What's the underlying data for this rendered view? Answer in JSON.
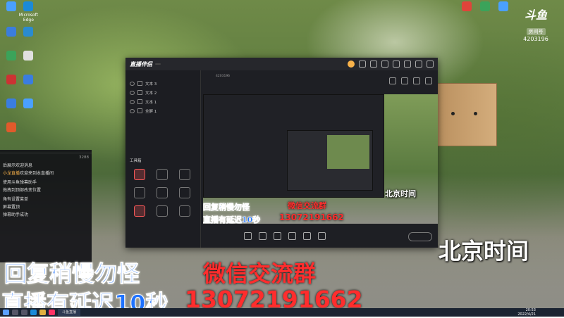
{
  "desktop": {
    "icons": [
      {
        "label": "",
        "color": "#4aa0ff"
      },
      {
        "label": "Microsoft Edge",
        "color": "#1b8ad8"
      },
      {
        "label": "",
        "color": "#3b7ddd"
      },
      {
        "label": "",
        "color": "#2a8bd0"
      },
      {
        "label": "",
        "color": "#3ba35a"
      },
      {
        "label": "",
        "color": "#e0e0e0"
      },
      {
        "label": "",
        "color": "#c33"
      },
      {
        "label": "",
        "color": "#3a7de0"
      },
      {
        "label": "",
        "color": "#3a7de0"
      },
      {
        "label": "",
        "color": "#4aa0ff"
      },
      {
        "label": "",
        "color": "#e05a2b"
      }
    ]
  },
  "top_right": {
    "icons": [
      {
        "color": "#e0443a"
      },
      {
        "color": "#3ba35a"
      },
      {
        "color": "#4aa0ff"
      },
      {
        "color": "#ddd"
      }
    ],
    "douyu": {
      "logo": "斗鱼",
      "room_label": "房间号",
      "room_number": "4203196"
    }
  },
  "app": {
    "brand": "直播伴侣",
    "brand_badge": "",
    "left_tabs": [
      "",
      "",
      ""
    ],
    "layers": [
      "文本 3",
      "文本 2",
      "文本 1",
      "全屏 1"
    ],
    "tools_title": "工具箱",
    "tools": [
      {
        "label": "",
        "highlight": true
      },
      {
        "label": "",
        "highlight": false
      },
      {
        "label": "",
        "highlight": false
      },
      {
        "label": "",
        "highlight": false
      },
      {
        "label": "",
        "highlight": false
      },
      {
        "label": "",
        "highlight": false
      },
      {
        "label": "",
        "highlight": true
      },
      {
        "label": "",
        "highlight": false
      },
      {
        "label": "",
        "highlight": false
      }
    ],
    "footer_text": "",
    "stream_title": "",
    "stream_meta": [
      "",
      "",
      "",
      "4203196"
    ],
    "bottom_buttons": [
      "",
      "",
      "",
      "",
      "",
      ""
    ],
    "start_button": ""
  },
  "chat": {
    "header_left": "",
    "header_right": "",
    "tabs": [
      "",
      "",
      "3288"
    ],
    "lines": [
      {
        "user": "",
        "text": "后展示欢迎消息"
      },
      {
        "user": "小龙直播",
        "text": "欢迎来到本直播间"
      },
      {
        "user": "",
        "text": ""
      },
      {
        "user": "",
        "text": "使用斗鱼弹幕助手"
      },
      {
        "user": "",
        "text": "拖拽到顶部改变位置"
      },
      {
        "user": "",
        "text": ""
      },
      {
        "user": "",
        "text": "角有设置菜单"
      },
      {
        "user": "",
        "text": "屏幕置顶"
      },
      {
        "user": "",
        "text": "弹幕助手成功"
      }
    ]
  },
  "overlays": {
    "reply_slow": "回复稍慢勿怪",
    "delay": "直播有延迟10秒",
    "wechat": "微信交流群",
    "phone": "13072191662",
    "beijing_time": "北京时间"
  },
  "taskbar": {
    "app_label": "斗鱼直播",
    "time": "20:53",
    "date": "2022/4/21"
  }
}
